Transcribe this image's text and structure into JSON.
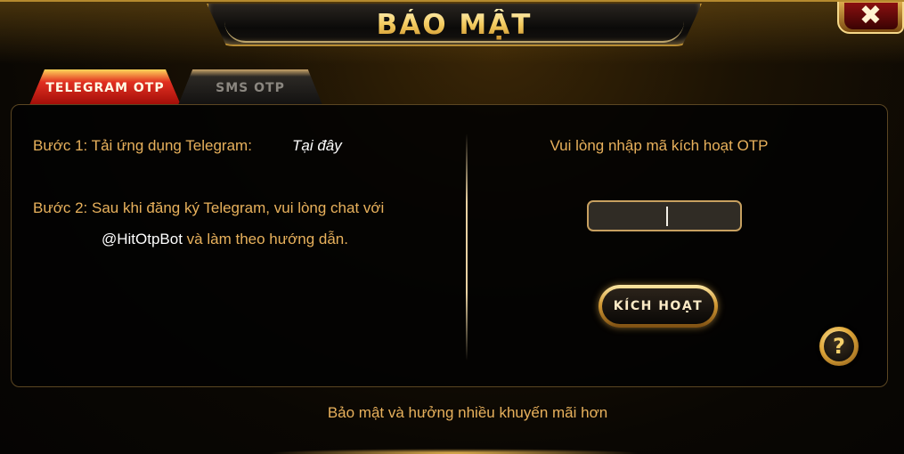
{
  "dialog": {
    "title": "BẢO MẬT",
    "close_icon": "close-x-icon",
    "help_icon": "question-mark-icon",
    "colors": {
      "accent_gold": "#e8b15c",
      "active_tab_red": "#c3170f",
      "panel_bg": "#050505"
    }
  },
  "tabs": [
    {
      "label": "TELEGRAM OTP",
      "active": true
    },
    {
      "label": "SMS OTP",
      "active": false
    }
  ],
  "steps": {
    "step1_text": "Bước 1: Tải ứng dụng Telegram:",
    "step1_link": "Tại đây",
    "step2_text": "Bước 2: Sau khi đăng ký Telegram, vui lòng chat với",
    "bot_name": "@HitOtpBot",
    "step2_suffix": " và làm theo hướng dẫn."
  },
  "otp": {
    "prompt": "Vui lòng nhập mã kích hoạt OTP",
    "value": "",
    "placeholder": "",
    "button_label": "KÍCH HOẠT"
  },
  "help_label": "?",
  "close_label": "✖",
  "footer": "Bảo mật và hưởng nhiều khuyến mãi hơn"
}
